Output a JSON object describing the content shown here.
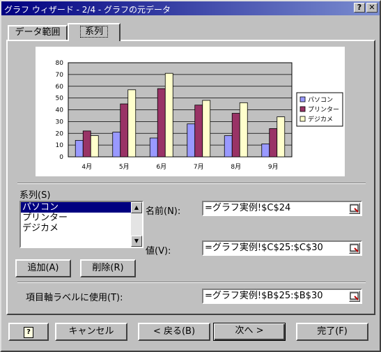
{
  "window": {
    "title": "グラフ ウィザード - 2/4 - グラフの元データ",
    "help_btn": "?",
    "close_btn": "✕"
  },
  "tabs": [
    {
      "label": "データ範囲"
    },
    {
      "label": "系列"
    }
  ],
  "series_section": {
    "label": "系列(S)",
    "items": [
      "パソコン",
      "プリンター",
      "デジカメ"
    ],
    "add": "追加(A)",
    "remove": "削除(R)"
  },
  "name": {
    "label": "名前(N):",
    "value": "=グラフ実例!$C$24"
  },
  "values": {
    "label": "値(V):",
    "value": "=グラフ実例!$C$25:$C$30"
  },
  "category": {
    "label": "項目軸ラベルに使用(T):",
    "value": "=グラフ実例!$B$25:$B$30"
  },
  "footer": {
    "help": "?",
    "cancel": "キャンセル",
    "back": "< 戻る(B)",
    "next": "次へ >",
    "finish": "完了(F)"
  },
  "colors": {
    "pc": "#9999ff",
    "printer": "#993366",
    "camera": "#ffffcc",
    "plot_bg": "#c0c0c0"
  },
  "chart_data": {
    "type": "bar",
    "categories": [
      "4月",
      "5月",
      "6月",
      "7月",
      "8月",
      "9月"
    ],
    "series": [
      {
        "name": "パソコン",
        "values": [
          14,
          21,
          16,
          28,
          18,
          11
        ]
      },
      {
        "name": "プリンター",
        "values": [
          22,
          45,
          58,
          44,
          37,
          24
        ]
      },
      {
        "name": "デジカメ",
        "values": [
          18,
          57,
          71,
          48,
          46,
          34
        ]
      }
    ],
    "ylim": [
      0,
      80
    ],
    "yticks": [
      0,
      10,
      20,
      30,
      40,
      50,
      60,
      70,
      80
    ],
    "grid": true,
    "legend": "right"
  }
}
